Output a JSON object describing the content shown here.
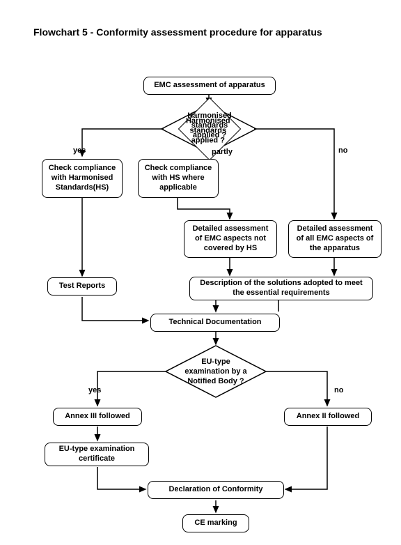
{
  "title": "Flowchart 5 - Conformity assessment procedure for apparatus",
  "n1": "EMC assessment  of  apparatus",
  "d1": "Harmonised\nstandards\napplied ?",
  "yes1": "yes",
  "partly": "partly",
  "no1": "no",
  "n2": "Check compliance with Harmonised Standards(HS)",
  "n3": "Check compliance with HS where applicable",
  "n4": "Detailed assessment of EMC aspects not covered by HS",
  "n5": "Detailed assessment of all EMC aspects of the apparatus",
  "n6": "Test Reports",
  "n7": "Description of the solutions adopted to meet the essential requirements",
  "n8": "Technical Documentation",
  "d2": "EU-type\nexamination by a\nNotified Body ?",
  "yes2": "yes",
  "no2": "no",
  "n9": "Annex III  followed",
  "n10": "Annex II  followed",
  "n11": "EU-type examination certificate",
  "n12": "Declaration of Conformity",
  "n13": "CE marking"
}
